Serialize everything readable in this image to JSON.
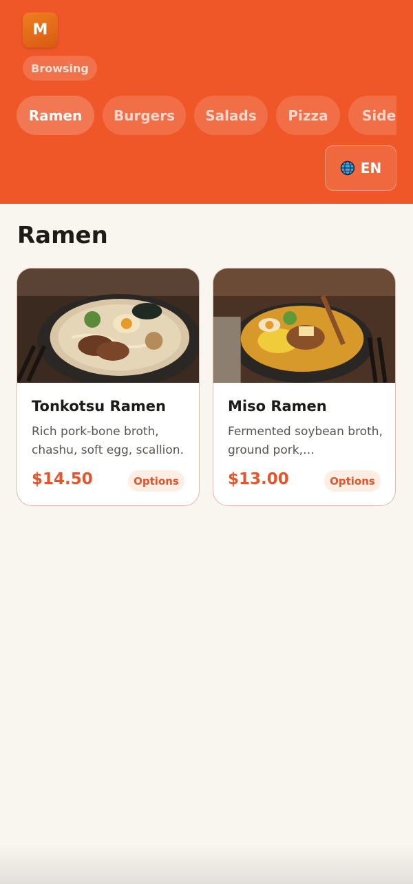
{
  "header": {
    "logo_letter": "M",
    "status": "Browsing",
    "brand_color": "#ef5728"
  },
  "categories": [
    {
      "label": "Ramen",
      "active": true
    },
    {
      "label": "Burgers",
      "active": false
    },
    {
      "label": "Salads",
      "active": false
    },
    {
      "label": "Pizza",
      "active": false
    },
    {
      "label": "Sides",
      "active": false
    }
  ],
  "language": {
    "icon": "globe-icon",
    "label": "EN"
  },
  "section": {
    "title": "Ramen"
  },
  "items": [
    {
      "name": "Tonkotsu Ramen",
      "description": "Rich pork-bone broth, chashu, soft egg, scallion.",
      "price": "$14.50",
      "options_label": "Options"
    },
    {
      "name": "Miso Ramen",
      "description": "Fermented soybean broth, ground pork,…",
      "price": "$13.00",
      "options_label": "Options"
    }
  ],
  "colors": {
    "accent": "#e4552b",
    "background": "#f9f6f0"
  }
}
